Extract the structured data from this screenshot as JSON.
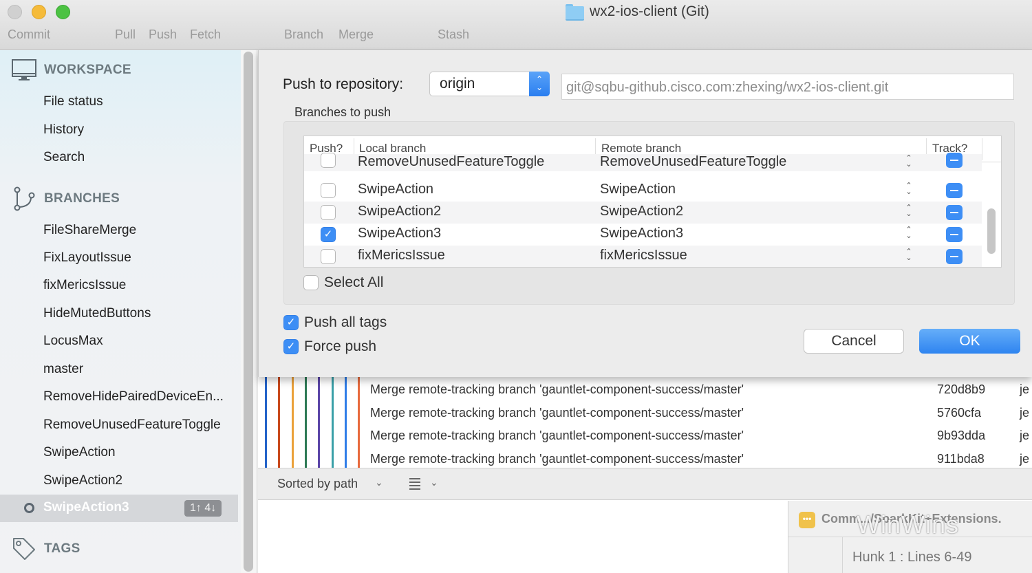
{
  "window": {
    "title": "wx2-ios-client (Git)",
    "toolbar": [
      "Commit",
      "Pull",
      "Push",
      "Fetch",
      "Branch",
      "Merge",
      "Stash"
    ]
  },
  "sidebar": {
    "workspace": {
      "label": "WORKSPACE",
      "icon": "monitor-icon",
      "items": [
        "File status",
        "History",
        "Search"
      ]
    },
    "branches": {
      "label": "BRANCHES",
      "icon": "branch-icon",
      "items": [
        "FileShareMerge",
        "FixLayoutIssue",
        "fixMericsIssue",
        "HideMutedButtons",
        "LocusMax",
        "master",
        "RemoveHidePairedDeviceEn...",
        "RemoveUnusedFeatureToggle",
        "SwipeAction",
        "SwipeAction2"
      ],
      "current": {
        "label": "SwipeAction3",
        "badge": "1↑ 4↓"
      }
    },
    "tags": {
      "label": "TAGS",
      "icon": "tag-icon"
    }
  },
  "dialog": {
    "push_label": "Push to repository:",
    "repository": "origin",
    "url": "git@sqbu-github.cisco.com:zhexing/wx2-ios-client.git",
    "branches_label": "Branches to push",
    "columns": [
      "Push?",
      "Local branch",
      "Remote branch",
      "Track?"
    ],
    "rows": [
      {
        "push": false,
        "local": "RemoveUnusedFeatureToggle",
        "remote": "RemoveUnusedFeatureToggle",
        "track": "mixed"
      },
      {
        "push": false,
        "local": "SwipeAction",
        "remote": "SwipeAction",
        "track": "mixed"
      },
      {
        "push": false,
        "local": "SwipeAction2",
        "remote": "SwipeAction2",
        "track": "mixed"
      },
      {
        "push": true,
        "local": "SwipeAction3",
        "remote": "SwipeAction3",
        "track": "mixed"
      },
      {
        "push": false,
        "local": "fixMericsIssue",
        "remote": "fixMericsIssue",
        "track": "mixed"
      }
    ],
    "select_all": {
      "label": "Select All",
      "checked": false
    },
    "push_all_tags": {
      "label": "Push all tags",
      "checked": true
    },
    "force_push": {
      "label": "Force push",
      "checked": true
    },
    "cancel_label": "Cancel",
    "ok_label": "OK",
    "accent_color": "#3d8ef5"
  },
  "history": {
    "lane_colors": [
      "#2563c9",
      "#c94a1e",
      "#eba13a",
      "#2e7a55",
      "#5b46a8",
      "#3aa0a8",
      "#2f7de8",
      "#e86b3e"
    ],
    "commits": [
      {
        "message": "Merge remote-tracking branch 'gauntlet-component-success/master'",
        "hash": "720d8b9",
        "author": "je"
      },
      {
        "message": "Merge remote-tracking branch 'gauntlet-component-success/master'",
        "hash": "5760cfa",
        "author": "je"
      },
      {
        "message": "Merge remote-tracking branch 'gauntlet-component-success/master'",
        "hash": "9b93dda",
        "author": "je"
      },
      {
        "message": "Merge remote-tracking branch 'gauntlet-component-success/master'",
        "hash": "911bda8",
        "author": "je"
      }
    ]
  },
  "files": {
    "sort_label": "Sorted by path",
    "diff_file": "Comm.../SparkKit+Extensions.",
    "hunk_label": "Hunk 1 : Lines 6-49"
  },
  "watermark": "WinWins"
}
